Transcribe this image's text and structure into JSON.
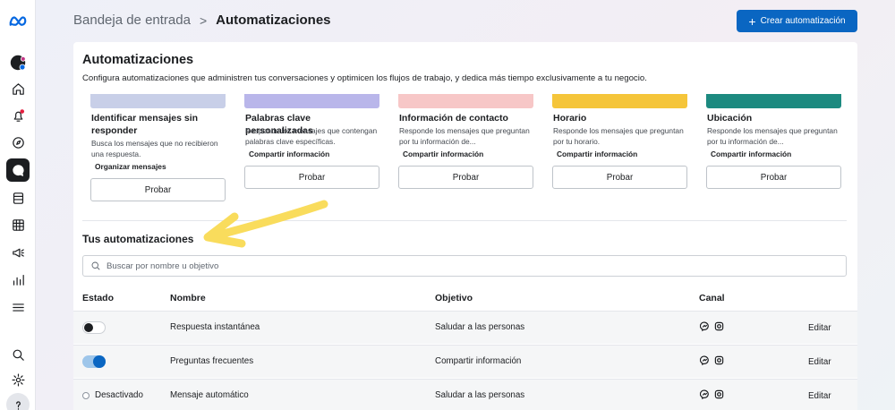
{
  "header": {
    "crumb_parent": "Bandeja de entrada",
    "crumb_separator": ">",
    "crumb_current": "Automatizaciones",
    "create_label": "Crear automatización"
  },
  "panel": {
    "title": "Automatizaciones",
    "description": "Configura automatizaciones que administren tus conversaciones y optimicen los flujos de trabajo, y dedica más tiempo exclusivamente a tu negocio."
  },
  "cards": [
    {
      "title": "Identificar mensajes sin responder",
      "description": "Busca los mensajes que no recibieron una respuesta.",
      "tag": "Organizar mensajes",
      "button": "Probar",
      "color": "#c8cfe8"
    },
    {
      "title": "Palabras clave personalizadas",
      "description": "Responde los mensajes que contengan palabras clave específicas.",
      "tag": "Compartir información",
      "button": "Probar",
      "color": "#b9b6ea"
    },
    {
      "title": "Información de contacto",
      "description": "Responde los mensajes que preguntan por tu información de...",
      "tag": "Compartir información",
      "button": "Probar",
      "color": "#f7c7c7"
    },
    {
      "title": "Horario",
      "description": "Responde los mensajes que preguntan por tu horario.",
      "tag": "Compartir información",
      "button": "Probar",
      "color": "#f5c53a"
    },
    {
      "title": "Ubicación",
      "description": "Responde los mensajes que preguntan por tu información de...",
      "tag": "Compartir información",
      "button": "Probar",
      "color": "#1c8a80"
    }
  ],
  "yours": {
    "title": "Tus automatizaciones",
    "search_placeholder": "Buscar por nombre u objetivo"
  },
  "table": {
    "headers": {
      "status": "Estado",
      "name": "Nombre",
      "goal": "Objetivo",
      "channel": "Canal"
    },
    "rows": [
      {
        "status": "",
        "toggle": "off",
        "name": "Respuesta instantánea",
        "goal": "Saludar a las personas",
        "action": "Editar"
      },
      {
        "status": "",
        "toggle": "on",
        "name": "Preguntas frecuentes",
        "goal": "Compartir información",
        "action": "Editar"
      },
      {
        "status": "Desactivado",
        "toggle": "none",
        "name": "Mensaje automático",
        "goal": "Saludar a las personas",
        "action": "Editar"
      }
    ]
  },
  "icons": [
    "meta-logo-icon",
    "profile-avatar-icon",
    "home-icon",
    "notifications-icon",
    "explore-icon",
    "inbox-icon",
    "content-icon",
    "planner-icon",
    "ads-icon",
    "insights-icon",
    "menu-icon",
    "search-icon",
    "settings-icon",
    "help-icon",
    "messenger-icon",
    "instagram-icon"
  ],
  "colors": {
    "accent": "#0a66c2",
    "meta_blue": "#0668e1",
    "notification_dot": "#e41e3f",
    "highlight_arrow": "#f9dc5c"
  }
}
